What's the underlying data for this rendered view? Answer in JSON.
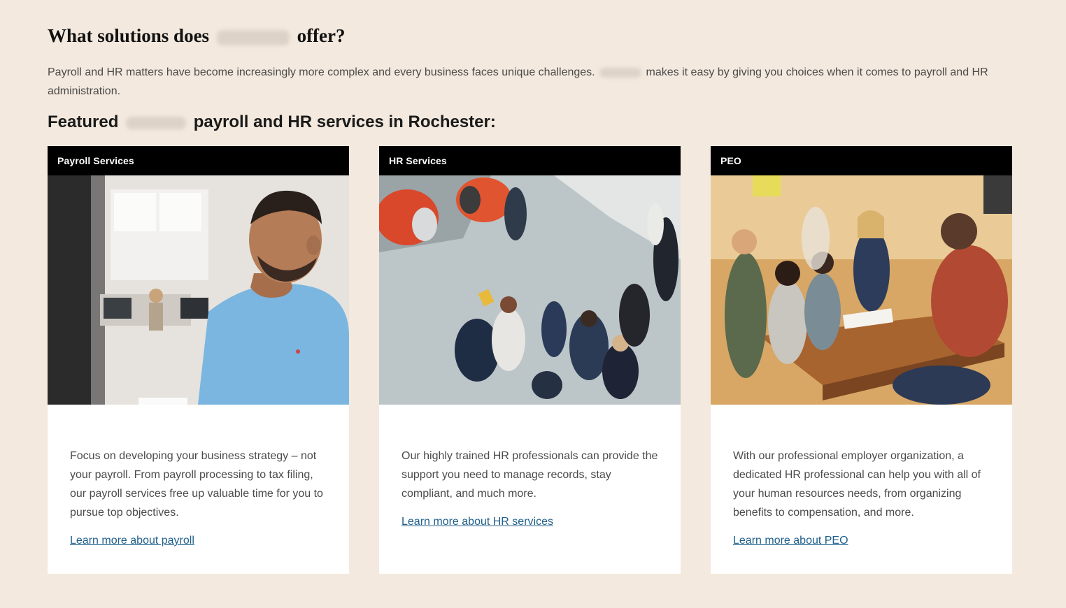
{
  "heading": {
    "before": "What solutions does",
    "after": "offer?"
  },
  "intro": {
    "before": "Payroll and HR matters have become increasingly more complex and every business faces unique challenges.",
    "after": "makes it easy by giving you choices when it comes to payroll and HR administration."
  },
  "subheading": {
    "before": "Featured",
    "after": "payroll and HR services in Rochester:"
  },
  "cards": [
    {
      "title": "Payroll Services",
      "text": "Focus on developing your business strategy – not your payroll. From payroll processing to tax filing, our payroll services free up valuable time for you to pursue top objectives.",
      "link": "Learn more about payroll"
    },
    {
      "title": "HR Services",
      "text": "Our highly trained HR professionals can provide the support you need to manage records, stay compliant, and much more.",
      "link": "Learn more about HR services"
    },
    {
      "title": "PEO",
      "text": "With our professional employer organization, a dedicated HR professional can help you with all of your human resources  needs, from organizing benefits to compensation, and more.",
      "link": "Learn more about PEO"
    }
  ],
  "colors": {
    "background": "#f3e9de",
    "card_header": "#000000",
    "link": "#1f5f8b"
  }
}
